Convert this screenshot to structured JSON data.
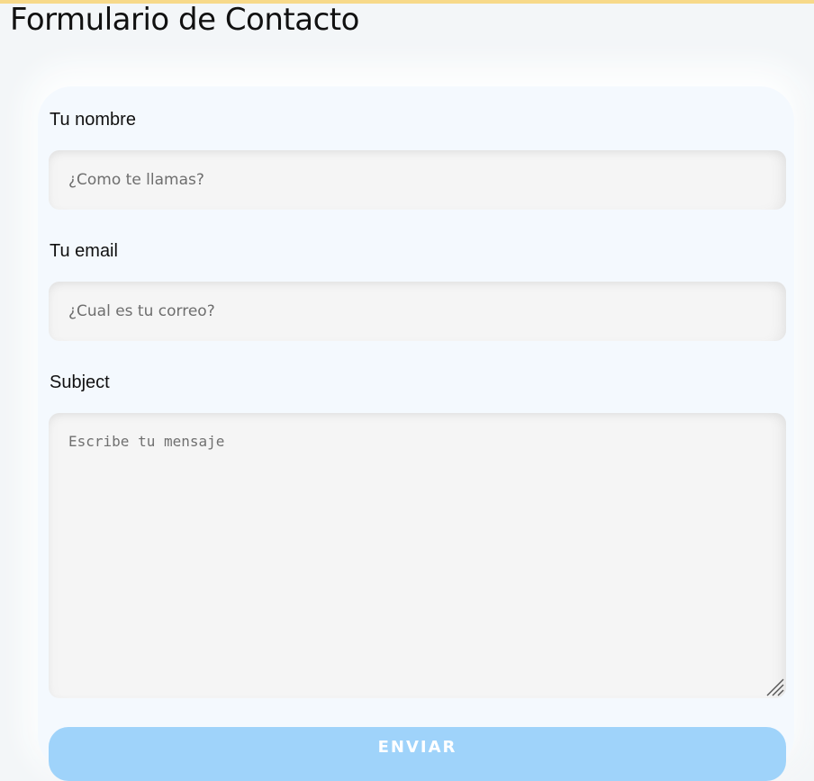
{
  "header": {
    "title": "Formulario de Contacto"
  },
  "form": {
    "name_label": "Tu nombre",
    "name_placeholder": "¿Como te llamas?",
    "email_label": "Tu email",
    "email_placeholder": "¿Cual es tu correo?",
    "subject_label": "Subject",
    "message_placeholder": "Escribe tu mensaje",
    "submit_label": "ENVIAR"
  },
  "colors": {
    "page_background": "#f3f6f8",
    "card_background": "#f4f9fe",
    "field_background": "#f5f5f5",
    "button_background": "#9fd3fa",
    "top_accent": "#f7d98a"
  },
  "icons": {
    "resize_handle": "resize-grip-icon"
  }
}
